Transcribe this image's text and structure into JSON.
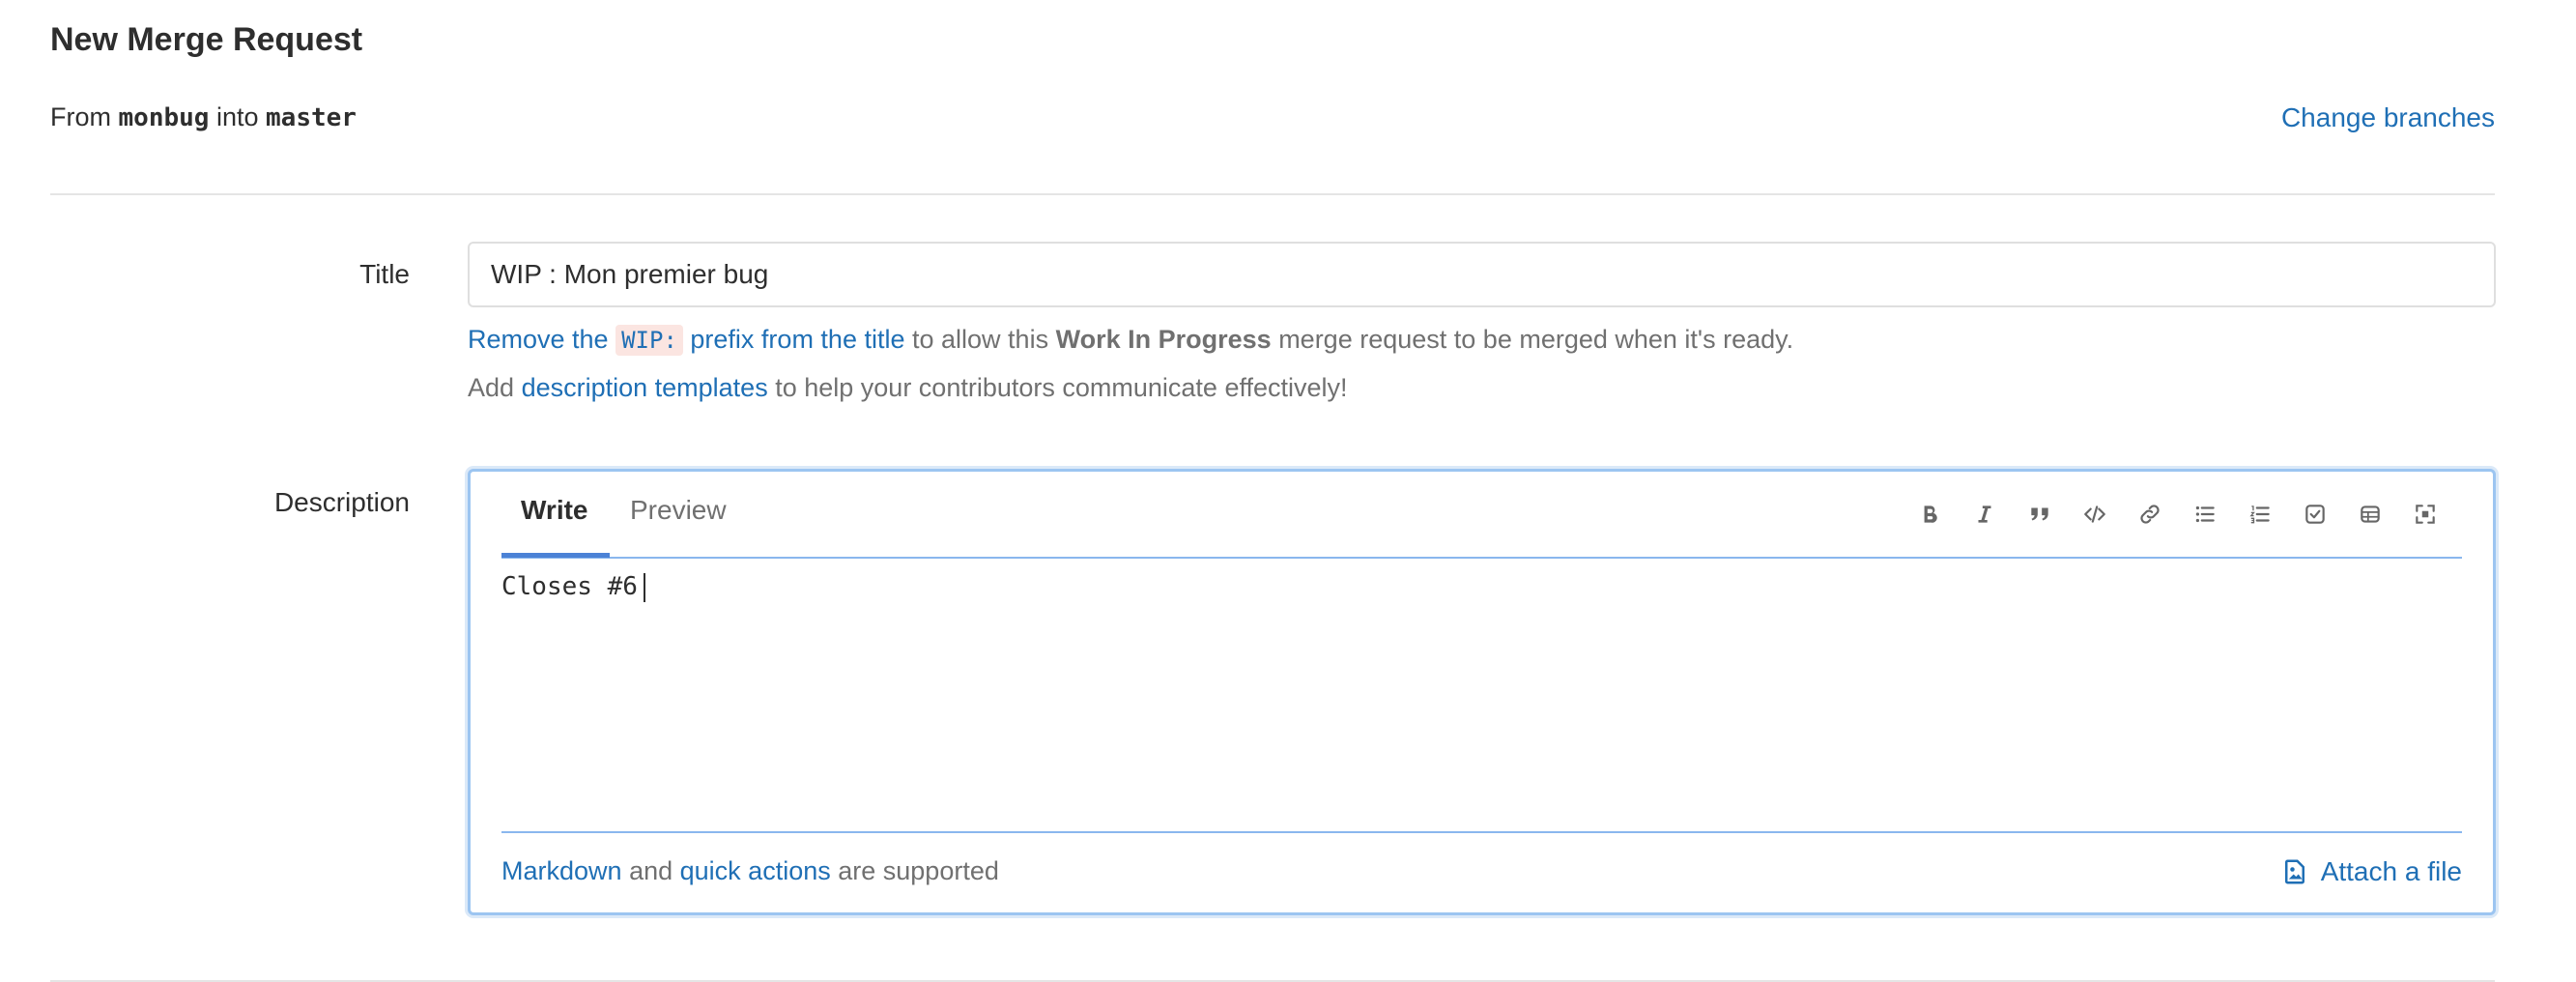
{
  "header": {
    "title": "New Merge Request",
    "from_word": "From",
    "source_branch": "monbug",
    "into_word": "into",
    "target_branch": "master",
    "change_branches": "Change branches"
  },
  "title_field": {
    "label": "Title",
    "value": "WIP : Mon premier bug",
    "wip_hint": {
      "link_start": "Remove the",
      "code": "WIP:",
      "link_end": "prefix from the title",
      "middle": "to allow this",
      "bold": "Work In Progress",
      "end": "merge request to be merged when it's ready."
    },
    "template_hint": {
      "start": "Add",
      "link": "description templates",
      "end": "to help your contributors communicate effectively!"
    }
  },
  "description": {
    "label": "Description",
    "tabs": {
      "write": "Write",
      "preview": "Preview"
    },
    "toolbar_icons": [
      "bold-icon",
      "italic-icon",
      "quote-icon",
      "code-icon",
      "link-icon",
      "bullet-list-icon",
      "numbered-list-icon",
      "task-list-icon",
      "table-icon",
      "fullscreen-icon"
    ],
    "value": "Closes #6",
    "footer": {
      "markdown": "Markdown",
      "and": "and",
      "quick_actions": "quick actions",
      "supported": "are supported",
      "attach": "Attach a file"
    }
  },
  "colors": {
    "link": "#1f6fb5",
    "focus_border": "#9cc5f1",
    "tab_underline": "#4b82d6"
  }
}
